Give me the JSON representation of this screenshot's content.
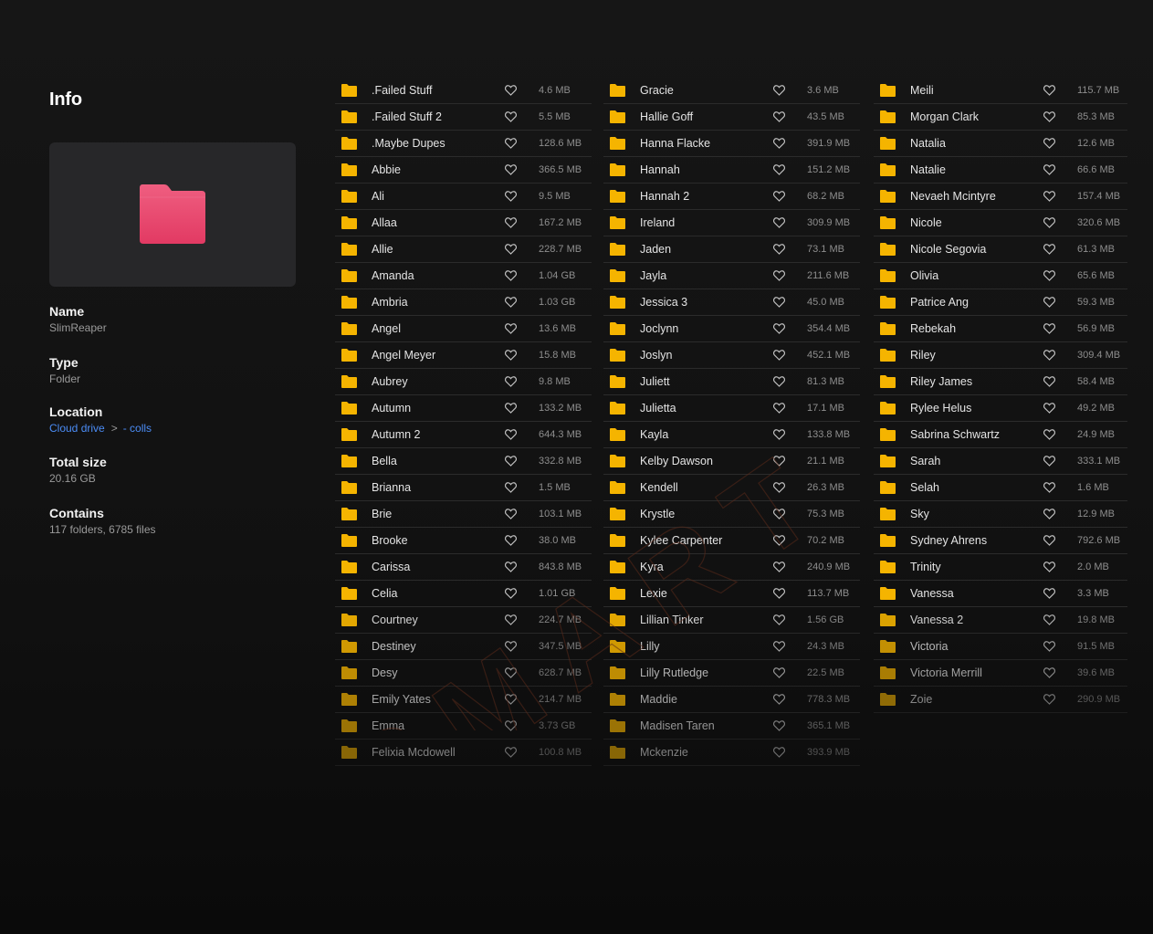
{
  "info": {
    "title": "Info",
    "name_label": "Name",
    "name_value": "SlimReaper",
    "type_label": "Type",
    "type_value": "Folder",
    "location_label": "Location",
    "location_root": "Cloud drive",
    "location_sub": "- colls",
    "total_size_label": "Total size",
    "total_size_value": "20.16 GB",
    "contains_label": "Contains",
    "contains_value": "117 folders, 6785 files"
  },
  "colors": {
    "folder": "#f5b400",
    "preview_folder": "#e8486d",
    "link": "#4b8cf5"
  },
  "icons": {
    "row_folder": "folder-icon",
    "favorite": "heart-icon",
    "location_separator": "chevron-right-icon"
  },
  "watermark": "SMART",
  "columns": [
    [
      {
        "name": ".Failed Stuff",
        "size": "4.6 MB"
      },
      {
        "name": ".Failed Stuff 2",
        "size": "5.5 MB"
      },
      {
        "name": ".Maybe Dupes",
        "size": "128.6 MB"
      },
      {
        "name": "Abbie",
        "size": "366.5 MB"
      },
      {
        "name": "Ali",
        "size": "9.5 MB"
      },
      {
        "name": "Allaa",
        "size": "167.2 MB"
      },
      {
        "name": "Allie",
        "size": "228.7 MB"
      },
      {
        "name": "Amanda",
        "size": "1.04 GB"
      },
      {
        "name": "Ambria",
        "size": "1.03 GB"
      },
      {
        "name": "Angel",
        "size": "13.6 MB"
      },
      {
        "name": "Angel Meyer",
        "size": "15.8 MB"
      },
      {
        "name": "Aubrey",
        "size": "9.8 MB"
      },
      {
        "name": "Autumn",
        "size": "133.2 MB"
      },
      {
        "name": "Autumn 2",
        "size": "644.3 MB"
      },
      {
        "name": "Bella",
        "size": "332.8 MB"
      },
      {
        "name": "Brianna",
        "size": "1.5 MB"
      },
      {
        "name": "Brie",
        "size": "103.1 MB"
      },
      {
        "name": "Brooke",
        "size": "38.0 MB"
      },
      {
        "name": "Carissa",
        "size": "843.8 MB"
      },
      {
        "name": "Celia",
        "size": "1.01 GB"
      },
      {
        "name": "Courtney",
        "size": "224.7 MB"
      },
      {
        "name": "Destiney",
        "size": "347.5 MB"
      },
      {
        "name": "Desy",
        "size": "628.7 MB"
      },
      {
        "name": "Emily Yates",
        "size": "214.7 MB"
      },
      {
        "name": "Emma",
        "size": "3.73 GB"
      },
      {
        "name": "Felixia Mcdowell",
        "size": "100.8 MB"
      }
    ],
    [
      {
        "name": "Gracie",
        "size": "3.6 MB"
      },
      {
        "name": "Hallie Goff",
        "size": "43.5 MB"
      },
      {
        "name": "Hanna Flacke",
        "size": "391.9 MB"
      },
      {
        "name": "Hannah",
        "size": "151.2 MB"
      },
      {
        "name": "Hannah 2",
        "size": "68.2 MB"
      },
      {
        "name": "Ireland",
        "size": "309.9 MB"
      },
      {
        "name": "Jaden",
        "size": "73.1 MB"
      },
      {
        "name": "Jayla",
        "size": "211.6 MB"
      },
      {
        "name": "Jessica 3",
        "size": "45.0 MB"
      },
      {
        "name": "Joclynn",
        "size": "354.4 MB"
      },
      {
        "name": "Joslyn",
        "size": "452.1 MB"
      },
      {
        "name": "Juliett",
        "size": "81.3 MB"
      },
      {
        "name": "Julietta",
        "size": "17.1 MB"
      },
      {
        "name": "Kayla",
        "size": "133.8 MB"
      },
      {
        "name": "Kelby Dawson",
        "size": "21.1 MB"
      },
      {
        "name": "Kendell",
        "size": "26.3 MB"
      },
      {
        "name": "Krystle",
        "size": "75.3 MB"
      },
      {
        "name": "Kylee Carpenter",
        "size": "70.2 MB"
      },
      {
        "name": "Kyra",
        "size": "240.9 MB"
      },
      {
        "name": "Lexie",
        "size": "113.7 MB"
      },
      {
        "name": "Lillian Tinker",
        "size": "1.56 GB"
      },
      {
        "name": "Lilly",
        "size": "24.3 MB"
      },
      {
        "name": "Lilly Rutledge",
        "size": "22.5 MB"
      },
      {
        "name": "Maddie",
        "size": "778.3 MB"
      },
      {
        "name": "Madisen Taren",
        "size": "365.1 MB"
      },
      {
        "name": "Mckenzie",
        "size": "393.9 MB"
      }
    ],
    [
      {
        "name": "Meili",
        "size": "115.7 MB"
      },
      {
        "name": "Morgan Clark",
        "size": "85.3 MB"
      },
      {
        "name": "Natalia",
        "size": "12.6 MB"
      },
      {
        "name": "Natalie",
        "size": "66.6 MB"
      },
      {
        "name": "Nevaeh Mcintyre",
        "size": "157.4 MB"
      },
      {
        "name": "Nicole",
        "size": "320.6 MB"
      },
      {
        "name": "Nicole Segovia",
        "size": "61.3 MB"
      },
      {
        "name": "Olivia",
        "size": "65.6 MB"
      },
      {
        "name": "Patrice Ang",
        "size": "59.3 MB"
      },
      {
        "name": "Rebekah",
        "size": "56.9 MB"
      },
      {
        "name": "Riley",
        "size": "309.4 MB"
      },
      {
        "name": "Riley James",
        "size": "58.4 MB"
      },
      {
        "name": "Rylee Helus",
        "size": "49.2 MB"
      },
      {
        "name": "Sabrina Schwartz",
        "size": "24.9 MB"
      },
      {
        "name": "Sarah",
        "size": "333.1 MB"
      },
      {
        "name": "Selah",
        "size": "1.6 MB"
      },
      {
        "name": "Sky",
        "size": "12.9 MB"
      },
      {
        "name": "Sydney Ahrens",
        "size": "792.6 MB"
      },
      {
        "name": "Trinity",
        "size": "2.0 MB"
      },
      {
        "name": "Vanessa",
        "size": "3.3 MB"
      },
      {
        "name": "Vanessa 2",
        "size": "19.8 MB"
      },
      {
        "name": "Victoria",
        "size": "91.5 MB"
      },
      {
        "name": "Victoria Merrill",
        "size": "39.6 MB"
      },
      {
        "name": "Zoie",
        "size": "290.9 MB"
      }
    ]
  ]
}
